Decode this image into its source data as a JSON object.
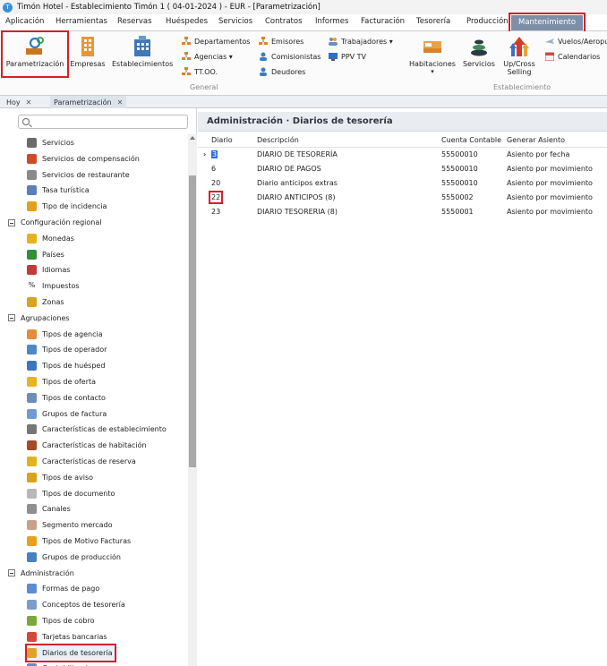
{
  "window": {
    "title": "Timón Hotel - Establecimiento Timón 1 ( 04-01-2024 ) - EUR - [Parametrización]"
  },
  "menu": [
    {
      "label": "Aplicación",
      "active": false
    },
    {
      "label": "Herramientas",
      "active": false
    },
    {
      "label": "Reservas",
      "active": false
    },
    {
      "label": "Huéspedes",
      "active": false
    },
    {
      "label": "Servicios",
      "active": false
    },
    {
      "label": "Contratos",
      "active": false
    },
    {
      "label": "Informes",
      "active": false
    },
    {
      "label": "Facturación",
      "active": false
    },
    {
      "label": "Tesorería",
      "active": false
    },
    {
      "label": "Producción",
      "active": false
    },
    {
      "label": "Mantenimiento",
      "active": true
    }
  ],
  "ribbon": {
    "large": [
      {
        "label": "Parametrización",
        "icon": "gears-icon"
      },
      {
        "label": "Empresas",
        "icon": "building-orange-icon"
      },
      {
        "label": "Establecimientos",
        "icon": "building-blue-icon"
      }
    ],
    "general_small": [
      {
        "label": "Departamentos",
        "icon": "org-chart-icon"
      },
      {
        "label": "Agencias ▾",
        "icon": "org-chart-icon"
      },
      {
        "label": "TT.OO.",
        "icon": "org-chart-icon"
      },
      {
        "label": "Emisores",
        "icon": "org-chart-icon"
      },
      {
        "label": "Comisionistas",
        "icon": "person-icon"
      },
      {
        "label": "Deudores",
        "icon": "person-icon"
      },
      {
        "label": "Trabajadores ▾",
        "icon": "workers-icon"
      },
      {
        "label": "PPV TV",
        "icon": "tv-icon"
      }
    ],
    "general_group": "General",
    "establecimiento_large": [
      {
        "label": "Habitaciones",
        "sub": "▾",
        "icon": "bed-icon"
      },
      {
        "label": "Servicios",
        "icon": "stones-icon"
      },
      {
        "label": "Up/Cross",
        "label2": "Selling",
        "icon": "arrows-up-icon"
      }
    ],
    "establecimiento_small": [
      {
        "label": "Vuelos/Aeropu",
        "icon": "plane-icon"
      },
      {
        "label": "Calendarios",
        "icon": "calendar-icon"
      }
    ],
    "establecimiento_group": "Establecimiento"
  },
  "tabs": [
    {
      "label": "Hoy"
    },
    {
      "label": "Parametrización"
    }
  ],
  "sidebar": {
    "search_placeholder": "",
    "items": [
      {
        "label": "Servicios",
        "kind": "leaf",
        "color": "#6b6b6b"
      },
      {
        "label": "Servicios de compensación",
        "kind": "leaf",
        "color": "#d04a2a"
      },
      {
        "label": "Servicios de restaurante",
        "kind": "leaf",
        "color": "#8a8a8a"
      },
      {
        "label": "Tasa turística",
        "kind": "leaf",
        "color": "#5b7fb8"
      },
      {
        "label": "Tipo de incidencia",
        "kind": "leaf",
        "color": "#e0a11b"
      },
      {
        "label": "Configuración regional",
        "kind": "group"
      },
      {
        "label": "Monedas",
        "kind": "leaf",
        "color": "#e8b21e"
      },
      {
        "label": "Países",
        "kind": "leaf",
        "color": "#2f8f3a"
      },
      {
        "label": "Idiomas",
        "kind": "leaf",
        "color": "#c23b3b"
      },
      {
        "label": "Impuestos",
        "kind": "leaf-text",
        "glyph": "%"
      },
      {
        "label": "Zonas",
        "kind": "leaf",
        "color": "#d9a21f"
      },
      {
        "label": "Agrupaciones",
        "kind": "group"
      },
      {
        "label": "Tipos de agencia",
        "kind": "leaf",
        "color": "#e58c3a"
      },
      {
        "label": "Tipos de operador",
        "kind": "leaf",
        "color": "#4f86c6"
      },
      {
        "label": "Tipos de huésped",
        "kind": "leaf",
        "color": "#3d74c0"
      },
      {
        "label": "Tipos de oferta",
        "kind": "leaf",
        "color": "#e6b422"
      },
      {
        "label": "Tipos de contacto",
        "kind": "leaf",
        "color": "#6b8fb8"
      },
      {
        "label": "Grupos de factura",
        "kind": "leaf",
        "color": "#6f9bd1"
      },
      {
        "label": "Características de establecimiento",
        "kind": "leaf",
        "color": "#777777"
      },
      {
        "label": "Características de habitación",
        "kind": "leaf",
        "color": "#a34b2a"
      },
      {
        "label": "Características de reserva",
        "kind": "leaf",
        "color": "#e2b21c"
      },
      {
        "label": "Tipos de aviso",
        "kind": "leaf",
        "color": "#d9a21f"
      },
      {
        "label": "Tipos de documento",
        "kind": "leaf",
        "color": "#b8b8b8"
      },
      {
        "label": "Canales",
        "kind": "leaf",
        "color": "#8f8f8f"
      },
      {
        "label": "Segmento mercado",
        "kind": "leaf",
        "color": "#c9a08a"
      },
      {
        "label": "Tipos de Motivo Facturas",
        "kind": "leaf",
        "color": "#e8a11a"
      },
      {
        "label": "Grupos de producción",
        "kind": "leaf",
        "color": "#4a7fc0"
      },
      {
        "label": "Administración",
        "kind": "group"
      },
      {
        "label": "Formas de pago",
        "kind": "leaf",
        "color": "#5a8ed0"
      },
      {
        "label": "Conceptos de tesorería",
        "kind": "leaf",
        "color": "#7a9ec8"
      },
      {
        "label": "Tipos de cobro",
        "kind": "leaf",
        "color": "#7aa83a"
      },
      {
        "label": "Tarjetas bancarias",
        "kind": "leaf",
        "color": "#d24a3a"
      },
      {
        "label": "Diarios de tesorería",
        "kind": "leaf",
        "color": "#e2a22a",
        "selected": true
      },
      {
        "label": "Contabilizaciones",
        "kind": "leaf",
        "color": "#5a8ed0"
      }
    ]
  },
  "main": {
    "header": "Administración · Diarios de tesorería",
    "columns": [
      "Diario",
      "Descripción",
      "Cuenta Contable",
      "Generar Asiento"
    ],
    "rows": [
      {
        "diario": "3",
        "descripcion": "DIARIO DE TESORERÍA",
        "cuenta": "55500010",
        "generar": "Asiento por fecha",
        "current": true
      },
      {
        "diario": "6",
        "descripcion": "DIARIO DE PAGOS",
        "cuenta": "55500010",
        "generar": "Asiento por movimiento"
      },
      {
        "diario": "20",
        "descripcion": "Diario anticipos extras",
        "cuenta": "55500010",
        "generar": "Asiento por movimiento"
      },
      {
        "diario": "22",
        "descripcion": "DIARIO ANTICIPOS (8)",
        "cuenta": "5550002",
        "generar": "Asiento por movimiento",
        "highlighted": true
      },
      {
        "diario": "23",
        "descripcion": "DIARIO TESORERIA (8)",
        "cuenta": "5550001",
        "generar": "Asiento por movimiento"
      }
    ]
  }
}
